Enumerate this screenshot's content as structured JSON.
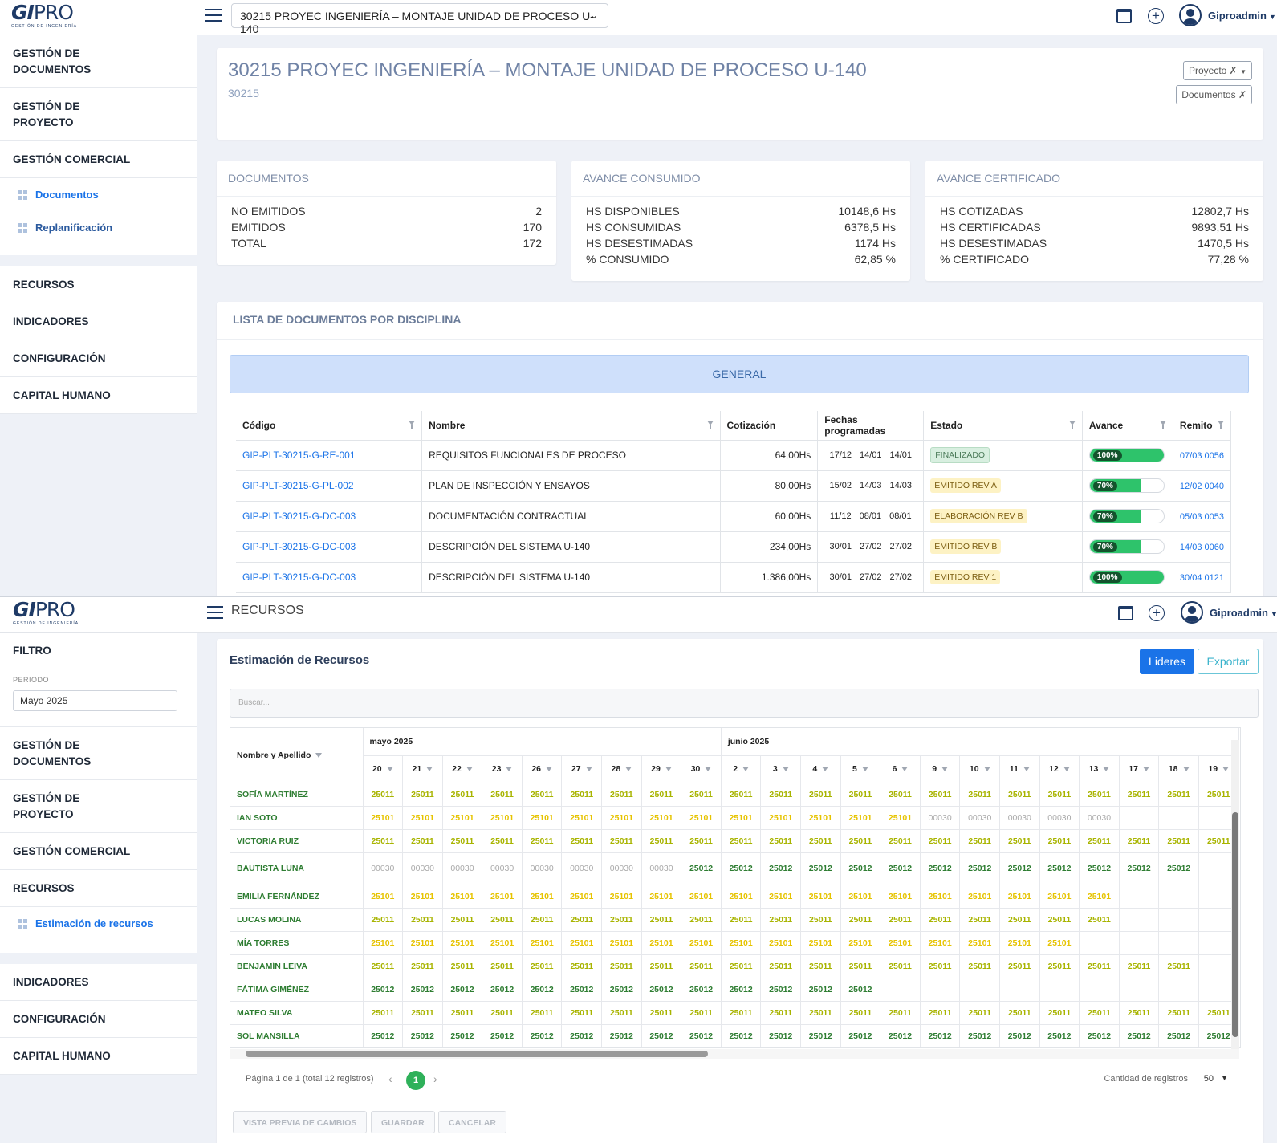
{
  "top1": {
    "logo_main": "GI",
    "logo_pro": "PRO",
    "logo_sub": "GESTIÓN DE INGENIERÍA",
    "project_select": "30215 PROYEC INGENIERÍA – MONTAJE UNIDAD DE PROCESO U-140",
    "user": "Giproadmin"
  },
  "sidebar1": {
    "items": [
      "GESTIÓN DE DOCUMENTOS",
      "GESTIÓN DE PROYECTO",
      "GESTIÓN COMERCIAL"
    ],
    "subitems": [
      "Documentos",
      "Replanificación"
    ],
    "items2": [
      "RECURSOS",
      "INDICADORES",
      "CONFIGURACIÓN",
      "CAPITAL HUMANO"
    ]
  },
  "project": {
    "title": "30215 PROYEC INGENIERÍA – MONTAJE UNIDAD DE PROCESO U-140",
    "code": "30215",
    "btn_proyecto": "Proyecto",
    "btn_documentos": "Documentos"
  },
  "stats": {
    "documentos": {
      "title": "DOCUMENTOS",
      "rows": [
        [
          "NO EMITIDOS",
          "2"
        ],
        [
          "EMITIDOS",
          "170"
        ],
        [
          "TOTAL",
          "172"
        ]
      ]
    },
    "consumido": {
      "title": "AVANCE CONSUMIDO",
      "rows": [
        [
          "HS DISPONIBLES",
          "10148,6 Hs"
        ],
        [
          "HS CONSUMIDAS",
          "6378,5 Hs"
        ],
        [
          "HS DESESTIMADAS",
          "1174 Hs"
        ],
        [
          "% CONSUMIDO",
          "62,85 %"
        ]
      ]
    },
    "certificado": {
      "title": "AVANCE CERTIFICADO",
      "rows": [
        [
          "HS COTIZADAS",
          "12802,7 Hs"
        ],
        [
          "HS CERTIFICADAS",
          "9893,51 Hs"
        ],
        [
          "HS DESESTIMADAS",
          "1470,5 Hs"
        ],
        [
          "% CERTIFICADO",
          "77,28 %"
        ]
      ]
    }
  },
  "doclist": {
    "title": "LISTA DE DOCUMENTOS POR DISCIPLINA",
    "group": "GENERAL",
    "columns": [
      "Código",
      "Nombre",
      "Cotización",
      "Fechas programadas",
      "Estado",
      "Avance",
      "Remito"
    ],
    "rows": [
      {
        "codigo": "GIP-PLT-30215-G-RE-001",
        "nombre": "REQUISITOS FUNCIONALES DE PROCESO",
        "cot": "64,00Hs",
        "f1": "17/12",
        "f2": "14/01",
        "f3": "14/01",
        "estado": "FINALIZADO",
        "estado_tipo": "fin",
        "avance": "100%",
        "avance_pct": 100,
        "remito": "07/03 0056"
      },
      {
        "codigo": "GIP-PLT-30215-G-PL-002",
        "nombre": "PLAN DE INSPECCIÓN Y ENSAYOS",
        "cot": "80,00Hs",
        "f1": "15/02",
        "f2": "14/03",
        "f3": "14/03",
        "estado": "EMITIDO REV A",
        "estado_tipo": "emi",
        "avance": "70%",
        "avance_pct": 70,
        "remito": "12/02 0040"
      },
      {
        "codigo": "GIP-PLT-30215-G-DC-003",
        "nombre": "DOCUMENTACIÓN CONTRACTUAL",
        "cot": "60,00Hs",
        "f1": "11/12",
        "f2": "08/01",
        "f3": "08/01",
        "estado": "ELABORACIÓN REV B",
        "estado_tipo": "emi",
        "avance": "70%",
        "avance_pct": 70,
        "remito": "05/03 0053"
      },
      {
        "codigo": "GIP-PLT-30215-G-DC-003",
        "nombre": "DESCRIPCIÓN DEL SISTEMA U-140",
        "cot": "234,00Hs",
        "f1": "30/01",
        "f2": "27/02",
        "f3": "27/02",
        "estado": "EMITIDO REV B",
        "estado_tipo": "emi",
        "avance": "70%",
        "avance_pct": 70,
        "remito": "14/03 0060"
      },
      {
        "codigo": "GIP-PLT-30215-G-DC-003",
        "nombre": "DESCRIPCIÓN DEL SISTEMA U-140",
        "cot": "1.386,00Hs",
        "f1": "30/01",
        "f2": "27/02",
        "f3": "27/02",
        "estado": "EMITIDO REV 1",
        "estado_tipo": "emi",
        "avance": "100%",
        "avance_pct": 100,
        "remito": "30/04 0121"
      }
    ]
  },
  "top2": {
    "section": "RECURSOS",
    "user": "Giproadmin"
  },
  "sidebar2": {
    "filtro": "FILTRO",
    "periodo_label": "PERIODO",
    "periodo_value": "Mayo 2025",
    "items": [
      "GESTIÓN DE DOCUMENTOS",
      "GESTIÓN DE PROYECTO",
      "GESTIÓN COMERCIAL",
      "RECURSOS"
    ],
    "subitem": "Estimación de recursos",
    "items2": [
      "INDICADORES",
      "CONFIGURACIÓN",
      "CAPITAL HUMANO"
    ]
  },
  "resources": {
    "title": "Estimación de Recursos",
    "btn_lideres": "Lideres",
    "btn_exportar": "Exportar",
    "search_placeholder": "Buscar...",
    "name_col": "Nombre y Apellido",
    "month1": "mayo 2025",
    "month2": "junio 2025",
    "days": [
      "20",
      "21",
      "22",
      "23",
      "26",
      "27",
      "28",
      "29",
      "30",
      "2",
      "3",
      "4",
      "5",
      "6",
      "9",
      "10",
      "11",
      "12",
      "13",
      "17",
      "18",
      "19"
    ],
    "rows": [
      {
        "name": "SOFÍA MARTÍNEZ",
        "cells": [
          "y",
          "y",
          "y",
          "y",
          "y",
          "y",
          "y",
          "y",
          "y",
          "y",
          "y",
          "y",
          "y",
          "y",
          "y",
          "y",
          "y",
          "y",
          "y",
          "y",
          "y",
          "y"
        ]
      },
      {
        "name": "IAN SOTO",
        "cells": [
          "Y",
          "Y",
          "Y",
          "Y",
          "Y",
          "Y",
          "Y",
          "Y",
          "Y",
          "Y",
          "Y",
          "Y",
          "Y",
          "Y",
          "x",
          "x",
          "x",
          "x",
          "x",
          "",
          "",
          ""
        ]
      },
      {
        "name": "VICTORIA RUIZ",
        "cells": [
          "y",
          "y",
          "y",
          "y",
          "y",
          "y",
          "y",
          "y",
          "y",
          "y",
          "y",
          "y",
          "y",
          "y",
          "y",
          "y",
          "y",
          "y",
          "y",
          "y",
          "y",
          "y"
        ]
      },
      {
        "name": "BAUTISTA LUNA",
        "cells": [
          "x",
          "x",
          "x",
          "x",
          "x",
          "x",
          "x",
          "x",
          "g",
          "g",
          "g",
          "g",
          "g",
          "g",
          "g",
          "g",
          "g",
          "g",
          "g",
          "g",
          "g",
          ""
        ]
      },
      {
        "name": "EMILIA FERNÁNDEZ",
        "cells": [
          "Y",
          "Y",
          "Y",
          "Y",
          "Y",
          "Y",
          "Y",
          "Y",
          "Y",
          "Y",
          "Y",
          "Y",
          "Y",
          "Y",
          "Y",
          "Y",
          "Y",
          "Y",
          "Y",
          "",
          "",
          ""
        ]
      },
      {
        "name": "LUCAS MOLINA",
        "cells": [
          "y",
          "y",
          "y",
          "y",
          "y",
          "y",
          "y",
          "y",
          "y",
          "y",
          "y",
          "y",
          "y",
          "y",
          "y",
          "y",
          "y",
          "y",
          "y",
          "",
          "",
          ""
        ]
      },
      {
        "name": "MÍA TORRES",
        "cells": [
          "Y",
          "Y",
          "Y",
          "Y",
          "Y",
          "Y",
          "Y",
          "Y",
          "Y",
          "Y",
          "Y",
          "Y",
          "Y",
          "Y",
          "Y",
          "Y",
          "Y",
          "Y",
          "",
          "",
          "",
          ""
        ]
      },
      {
        "name": "BENJAMÍN LEIVA",
        "cells": [
          "y",
          "y",
          "y",
          "y",
          "y",
          "y",
          "y",
          "y",
          "y",
          "y",
          "y",
          "y",
          "y",
          "y",
          "y",
          "y",
          "y",
          "y",
          "y",
          "y",
          "y",
          ""
        ]
      },
      {
        "name": "FÁTIMA GIMÉNEZ",
        "cells": [
          "g",
          "g",
          "g",
          "g",
          "g",
          "g",
          "g",
          "g",
          "g",
          "g",
          "g",
          "g",
          "g",
          "",
          "",
          "",
          "",
          "",
          "",
          "",
          "",
          ""
        ]
      },
      {
        "name": "MATEO SILVA",
        "cells": [
          "y",
          "y",
          "y",
          "y",
          "y",
          "y",
          "y",
          "y",
          "y",
          "y",
          "y",
          "y",
          "y",
          "y",
          "y",
          "y",
          "y",
          "y",
          "y",
          "y",
          "y",
          "y"
        ]
      },
      {
        "name": "SOL MANSILLA",
        "cells": [
          "g",
          "g",
          "g",
          "g",
          "g",
          "g",
          "g",
          "g",
          "g",
          "g",
          "g",
          "g",
          "g",
          "g",
          "g",
          "g",
          "g",
          "g",
          "g",
          "g",
          "g",
          "g"
        ]
      }
    ],
    "codes": {
      "y": "25011",
      "Y": "25101",
      "g": "25012",
      "x": "00030"
    },
    "pager_info": "Página 1 de 1 (total 12 registros)",
    "page": "1",
    "cantidad_label": "Cantidad de registros",
    "cantidad_value": "50",
    "btn_preview": "VISTA PREVIA DE CAMBIOS",
    "btn_guardar": "GUARDAR",
    "btn_cancelar": "CANCELAR"
  }
}
